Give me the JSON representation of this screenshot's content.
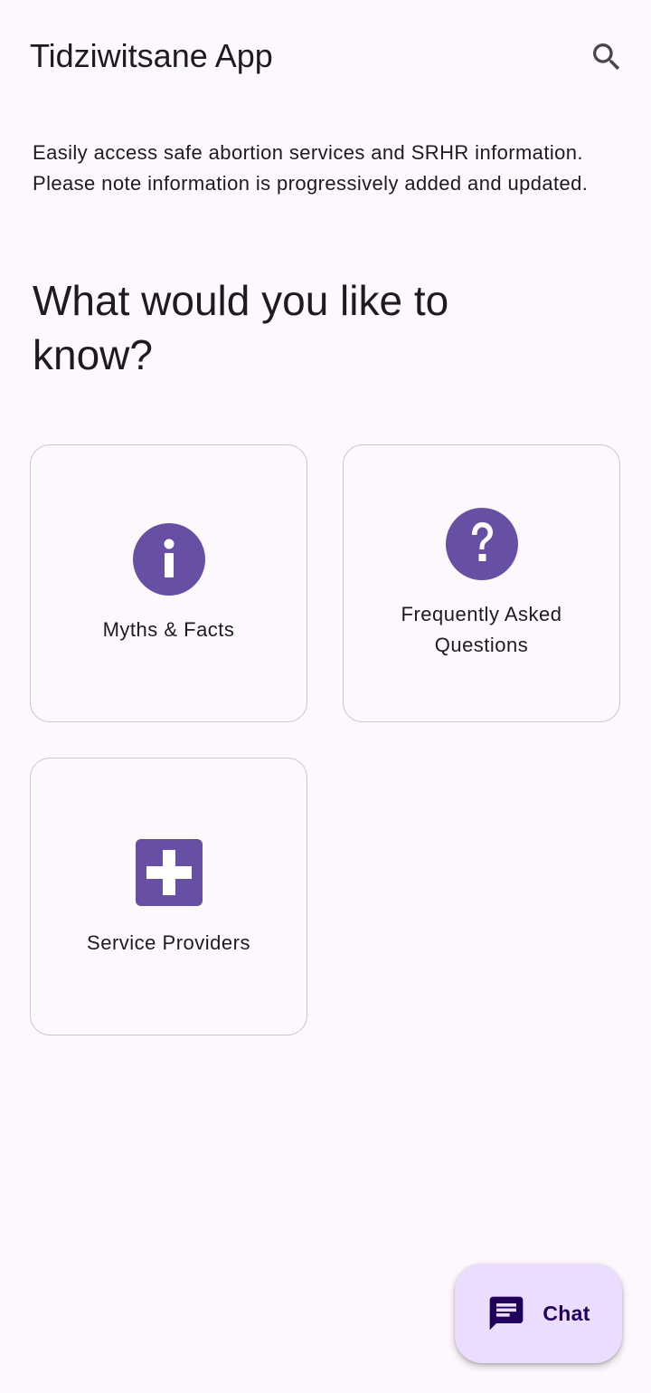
{
  "app_bar": {
    "title": "Tidziwitsane App",
    "search_icon": "search-icon"
  },
  "intro_text": "Easily access safe abortion services and SRHR information. Please note information is progressively added and updated.",
  "heading": "What would you like to know?",
  "cards": [
    {
      "label": "Myths & Facts",
      "icon": "info-icon"
    },
    {
      "label": "Frequently Asked Questions",
      "icon": "help-icon"
    },
    {
      "label": "Service Providers",
      "icon": "medical-cross-icon"
    }
  ],
  "chat_button": {
    "label": "Chat",
    "icon": "chat-icon"
  },
  "colors": {
    "background": "#fdf8fc",
    "accent": "#6750a4",
    "fab_background": "#eaddff",
    "fab_content": "#21005d",
    "card_border": "#cac4cf",
    "text": "#1d1b20"
  }
}
